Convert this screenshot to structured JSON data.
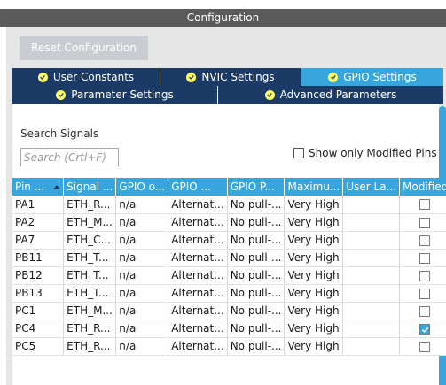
{
  "panel": {
    "title": "Configuration"
  },
  "toolbar": {
    "reset_label": "Reset Configuration"
  },
  "tabs": {
    "row1": [
      {
        "label": "User Constants",
        "active": false
      },
      {
        "label": "NVIC Settings",
        "active": false
      },
      {
        "label": "GPIO Settings",
        "active": true
      }
    ],
    "row2": [
      {
        "label": "Parameter Settings",
        "active": false
      },
      {
        "label": "Advanced Parameters",
        "active": false
      }
    ]
  },
  "search": {
    "label": "Search Signals",
    "placeholder": "Search (Crtl+F)",
    "value": ""
  },
  "filter": {
    "modified_only_label": "Show only Modified Pins",
    "checked": false
  },
  "table": {
    "columns": [
      "Pin ...",
      "Signal ...",
      "GPIO o...",
      "GPIO ...",
      "GPIO P...",
      "Maximu...",
      "User La...",
      "Modified"
    ],
    "rows": [
      {
        "pin": "PA1",
        "signal": "ETH_R...",
        "output": "n/a",
        "mode": "Alternat...",
        "pull": "No pull-...",
        "speed": "Very High",
        "user_label": "",
        "modified": false
      },
      {
        "pin": "PA2",
        "signal": "ETH_M...",
        "output": "n/a",
        "mode": "Alternat...",
        "pull": "No pull-...",
        "speed": "Very High",
        "user_label": "",
        "modified": false
      },
      {
        "pin": "PA7",
        "signal": "ETH_C...",
        "output": "n/a",
        "mode": "Alternat...",
        "pull": "No pull-...",
        "speed": "Very High",
        "user_label": "",
        "modified": false
      },
      {
        "pin": "PB11",
        "signal": "ETH_T...",
        "output": "n/a",
        "mode": "Alternat...",
        "pull": "No pull-...",
        "speed": "Very High",
        "user_label": "",
        "modified": false
      },
      {
        "pin": "PB12",
        "signal": "ETH_T...",
        "output": "n/a",
        "mode": "Alternat...",
        "pull": "No pull-...",
        "speed": "Very High",
        "user_label": "",
        "modified": false
      },
      {
        "pin": "PB13",
        "signal": "ETH_T...",
        "output": "n/a",
        "mode": "Alternat...",
        "pull": "No pull-...",
        "speed": "Very High",
        "user_label": "",
        "modified": false
      },
      {
        "pin": "PC1",
        "signal": "ETH_M...",
        "output": "n/a",
        "mode": "Alternat...",
        "pull": "No pull-...",
        "speed": "Very High",
        "user_label": "",
        "modified": false
      },
      {
        "pin": "PC4",
        "signal": "ETH_R...",
        "output": "n/a",
        "mode": "Alternat...",
        "pull": "No pull-...",
        "speed": "Very High",
        "user_label": "",
        "modified": true
      },
      {
        "pin": "PC5",
        "signal": "ETH_R...",
        "output": "n/a",
        "mode": "Alternat...",
        "pull": "No pull-...",
        "speed": "Very High",
        "user_label": "",
        "modified": false
      }
    ]
  },
  "colors": {
    "accent": "#37a6dc",
    "tab_bg": "#1b3a66",
    "check_badge": "#ffff66"
  },
  "icons": {
    "tab_status": "check-circle-icon",
    "sort": "sort-ascending-icon"
  }
}
